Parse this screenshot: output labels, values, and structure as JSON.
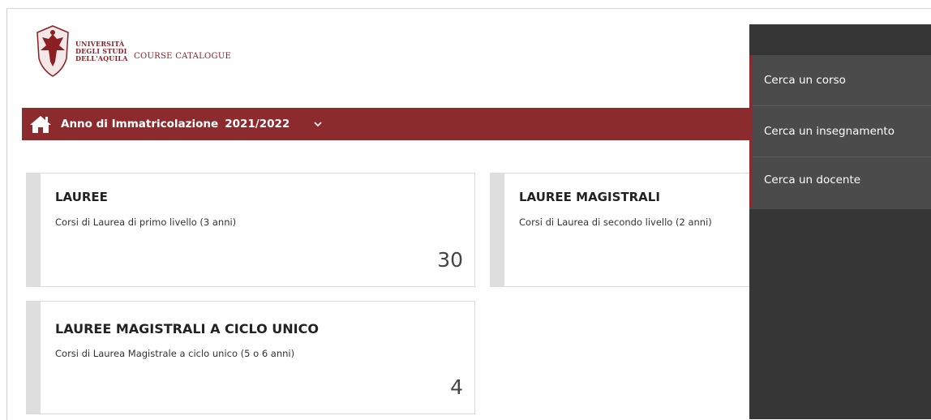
{
  "header": {
    "university_lines": [
      "UNIVERSITÀ",
      "DEGLI STUDI",
      "DELL'AQUILA"
    ],
    "catalogue_title": "COURSE CATALOGUE"
  },
  "nav": {
    "label": "Anno di Immatricolazione",
    "year": "2021/2022"
  },
  "cards": [
    {
      "title": "LAUREE",
      "description": "Corsi di Laurea di primo livello (3 anni)",
      "count": "30"
    },
    {
      "title": "LAUREE MAGISTRALI",
      "description": "Corsi di Laurea di secondo livello (2 anni)",
      "count": ""
    },
    {
      "title": "LAUREE MAGISTRALI A CICLO UNICO",
      "description": "Corsi di Laurea Magistrale a ciclo unico (5 o 6 anni)",
      "count": "4"
    }
  ],
  "side_menu": {
    "items": [
      "Cerca un corso",
      "Cerca un insegnamento",
      "Cerca un docente"
    ]
  },
  "colors": {
    "brand": "#8c2b2e",
    "panel": "#363636",
    "menu": "#4b4b4b"
  },
  "icons": {
    "logo": "university-eagle-crest",
    "home": "home-icon",
    "chevron": "chevron-down-icon"
  }
}
